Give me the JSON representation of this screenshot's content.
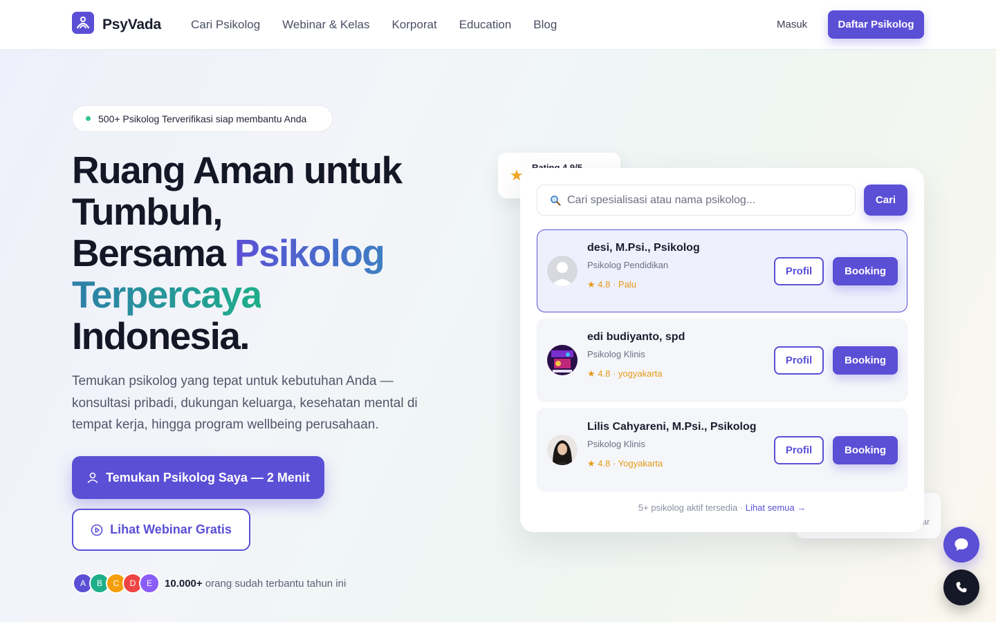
{
  "nav": {
    "brand": "PsyVada",
    "links": [
      "Cari Psikolog",
      "Webinar & Kelas",
      "Korporat",
      "Education",
      "Blog"
    ],
    "login": "Masuk",
    "register": "Daftar Psikolog"
  },
  "hero": {
    "pill": "500+ Psikolog Terverifikasi siap membantu Anda",
    "title_line1": "Ruang Aman untuk",
    "title_line2": "Tumbuh,",
    "title_line3a": "Bersama ",
    "title_line3b": "Psikolog",
    "title_line4": "Terpercaya",
    "title_line5": "Indonesia.",
    "description": "Temukan psikolog yang tepat untuk kebutuhan Anda — konsultasi pribadi, dukungan keluarga, kesehatan mental di tempat kerja, hingga program wellbeing perusahaan.",
    "cta_primary": "Temukan Psikolog Saya — 2 Menit",
    "cta_secondary": "Lihat Webinar Gratis",
    "avatars": [
      "A",
      "B",
      "C",
      "D",
      "E"
    ],
    "social_count": "10.000+",
    "social_text": " orang sudah terbantu tahun ini"
  },
  "rating_badge": {
    "text": "Rating 4.9/5"
  },
  "bottom_badge": {
    "text": "ar"
  },
  "finder": {
    "search_placeholder": "Cari spesialisasi atau nama psikolog...",
    "search_button": "Cari",
    "psychologists": [
      {
        "name": "desi, M.Psi., Psikolog",
        "specialty": "Psikolog Pendidikan",
        "meta": "4.8 · Palu",
        "profile": "Profil",
        "booking": "Booking"
      },
      {
        "name": "edi budiyanto, spd",
        "specialty": "Psikolog Klinis",
        "meta": "4.8 · yogyakarta",
        "profile": "Profil",
        "booking": "Booking"
      },
      {
        "name": "Lilis Cahyareni, M.Psi., Psikolog",
        "specialty": "Psikolog Klinis",
        "meta": "4.8 · Yogyakarta",
        "profile": "Profil",
        "booking": "Booking"
      }
    ],
    "footer_text": "5+ psikolog aktif tersedia · ",
    "footer_link": "Lihat semua →"
  },
  "colors": {
    "primary": "#5b4fd6",
    "accent_green": "#1fae8a",
    "star": "#f5a623"
  },
  "icons": [
    "logo-icon",
    "user-icon",
    "play-circle-icon",
    "search-icon",
    "star-icon",
    "chat-icon",
    "phone-icon"
  ]
}
